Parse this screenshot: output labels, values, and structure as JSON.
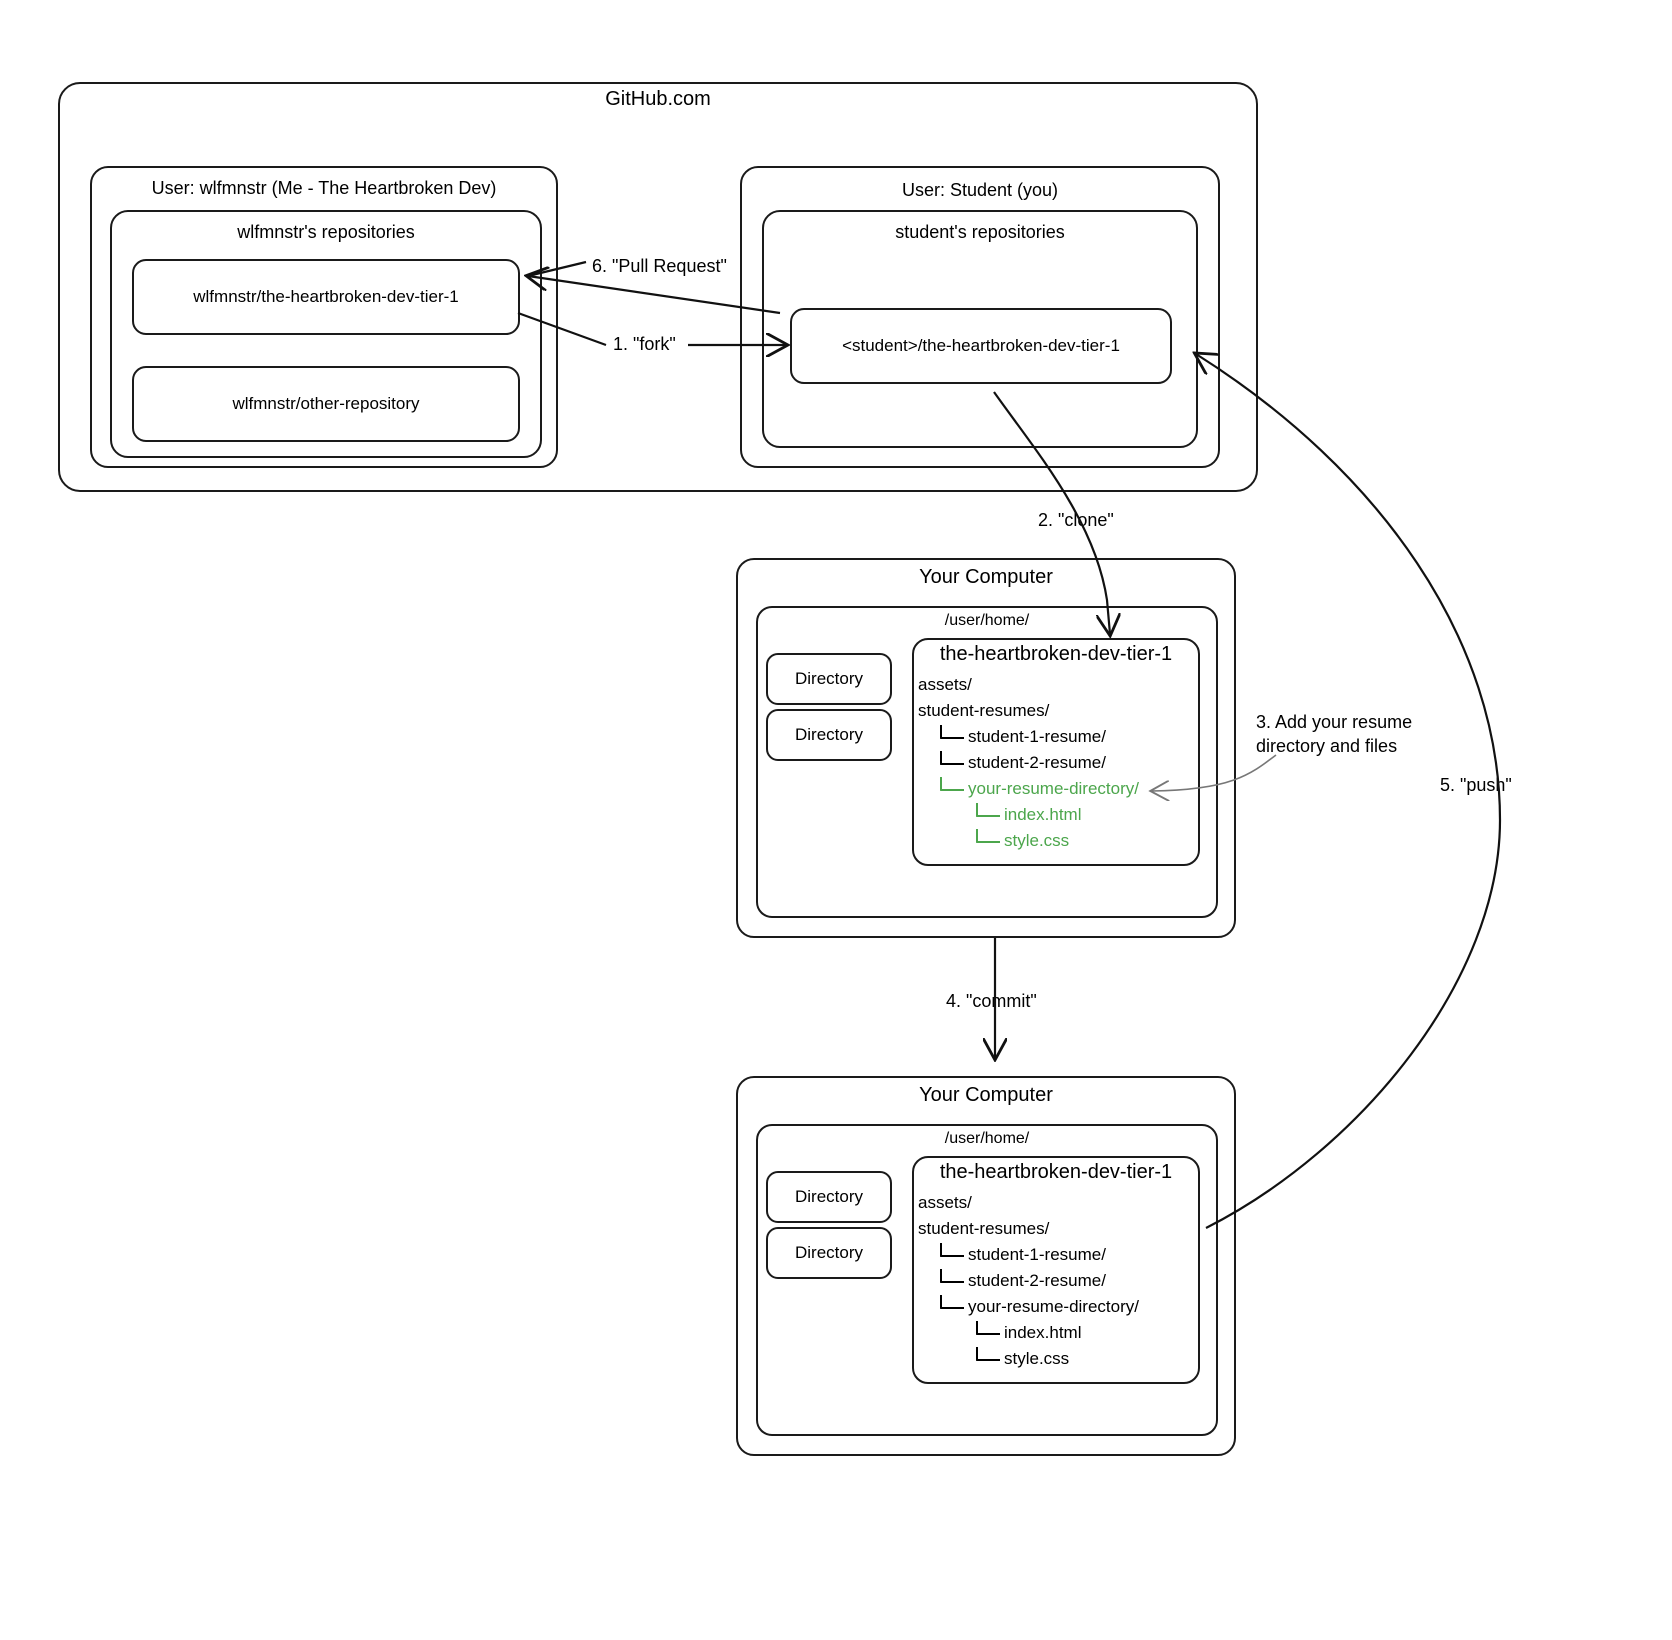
{
  "colors": {
    "stroke": "#1a1a1a",
    "green": "#4ca64c",
    "text": "#000000",
    "background": "#ffffff"
  },
  "github": {
    "title": "GitHub.com",
    "owner_user": {
      "title": "User: wlfmnstr (Me - The Heartbroken Dev)",
      "repos_title": "wlfmnstr's repositories",
      "repos": [
        "wlfmnstr/the-heartbroken-dev-tier-1",
        "wlfmnstr/other-repository"
      ]
    },
    "student_user": {
      "title": "User: Student (you)",
      "repos_title": "student's repositories",
      "repos": [
        "<student>/the-heartbroken-dev-tier-1"
      ]
    }
  },
  "steps": {
    "fork": "1. \"fork\"",
    "clone": "2. \"clone\"",
    "add": "3. Add your resume\ndirectory and files",
    "add_line1": "3. Add your resume",
    "add_line2": "directory and files",
    "commit": "4. \"commit\"",
    "push": "5. \"push\"",
    "pull_request": "6. \"Pull Request\""
  },
  "computer_top": {
    "title": "Your Computer",
    "home_title": "/user/home/",
    "directories": [
      "Directory",
      "Directory"
    ],
    "repo_title": "the-heartbroken-dev-tier-1",
    "tree": [
      {
        "label": "assets/",
        "depth": 0,
        "green": false,
        "connector": false
      },
      {
        "label": "student-resumes/",
        "depth": 0,
        "green": false,
        "connector": false
      },
      {
        "label": "student-1-resume/",
        "depth": 1,
        "green": false,
        "connector": true
      },
      {
        "label": "student-2-resume/",
        "depth": 1,
        "green": false,
        "connector": true
      },
      {
        "label": "your-resume-directory/",
        "depth": 1,
        "green": true,
        "connector": true
      },
      {
        "label": "index.html",
        "depth": 2,
        "green": true,
        "connector": true
      },
      {
        "label": "style.css",
        "depth": 2,
        "green": true,
        "connector": true
      }
    ]
  },
  "computer_bottom": {
    "title": "Your Computer",
    "home_title": "/user/home/",
    "directories": [
      "Directory",
      "Directory"
    ],
    "repo_title": "the-heartbroken-dev-tier-1",
    "tree": [
      {
        "label": "assets/",
        "depth": 0,
        "green": false,
        "connector": false
      },
      {
        "label": "student-resumes/",
        "depth": 0,
        "green": false,
        "connector": false
      },
      {
        "label": "student-1-resume/",
        "depth": 1,
        "green": false,
        "connector": true
      },
      {
        "label": "student-2-resume/",
        "depth": 1,
        "green": false,
        "connector": true
      },
      {
        "label": "your-resume-directory/",
        "depth": 1,
        "green": false,
        "connector": true
      },
      {
        "label": "index.html",
        "depth": 2,
        "green": false,
        "connector": true
      },
      {
        "label": "style.css",
        "depth": 2,
        "green": false,
        "connector": true
      }
    ]
  }
}
